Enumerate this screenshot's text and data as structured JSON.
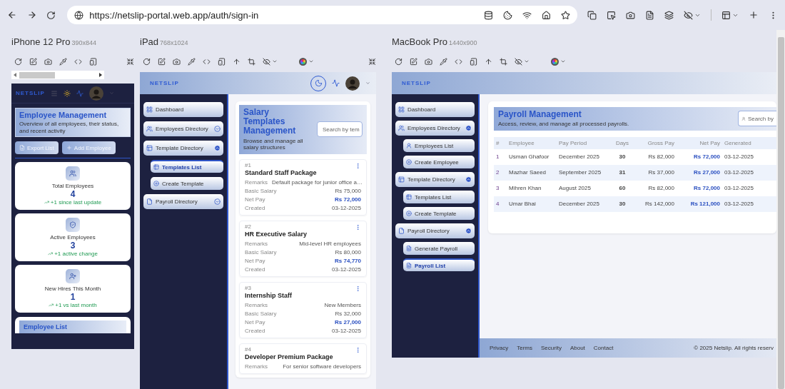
{
  "browser": {
    "url": "https://netslip-portal.web.app/auth/sign-in"
  },
  "devices": [
    {
      "kind": "phone",
      "name": "iPhone 12 Pro",
      "size": "390x844",
      "screen": {
        "brand": "NETSLIP",
        "title": "Employee Management",
        "subtitle": "Overview of all employees, their status, and recent activity",
        "actions": [
          "Export List",
          "Add Employee"
        ],
        "stats": [
          {
            "label": "Total Employees",
            "value": "4",
            "change": "+1 since last update"
          },
          {
            "label": "Active Employees",
            "value": "3",
            "change": "+1 active change"
          },
          {
            "label": "New Hires This Month",
            "value": "1",
            "change": "+1 vs last month"
          }
        ],
        "list_title": "Employee List"
      }
    },
    {
      "kind": "tablet",
      "name": "iPad",
      "size": "768x1024",
      "screen": {
        "brand": "NETSLIP",
        "sidebar": [
          {
            "label": "Dashboard",
            "selected": false
          },
          {
            "label": "Employees Directory",
            "selected": false,
            "expanded": false
          },
          {
            "label": "Template Directory",
            "selected": false,
            "expanded": true,
            "children": [
              {
                "label": "Templates List",
                "selected": true
              },
              {
                "label": "Create Template",
                "selected": false
              }
            ]
          },
          {
            "label": "Payroll Directory",
            "selected": false,
            "expanded": false
          }
        ],
        "title": "Salary Templates Management",
        "subtitle": "Browse and manage all salary structures",
        "search_placeholder": "Search by tem",
        "templates": [
          {
            "number": "#1",
            "name": "Standard Staff Package",
            "fields": [
              {
                "label": "Remarks",
                "value": "Default package for junior office a…",
                "highlight": false
              },
              {
                "label": "Basic Salary",
                "value": "Rs 75,000",
                "highlight": false
              },
              {
                "label": "Net Pay",
                "value": "Rs 72,000",
                "highlight": true
              },
              {
                "label": "Created",
                "value": "03-12-2025",
                "highlight": false
              }
            ]
          },
          {
            "number": "#2",
            "name": "HR Executive Salary",
            "fields": [
              {
                "label": "Remarks",
                "value": "Mid-level HR employees",
                "highlight": false
              },
              {
                "label": "Basic Salary",
                "value": "Rs 80,000",
                "highlight": false
              },
              {
                "label": "Net Pay",
                "value": "Rs 74,770",
                "highlight": true
              },
              {
                "label": "Created",
                "value": "03-12-2025",
                "highlight": false
              }
            ]
          },
          {
            "number": "#3",
            "name": "Internship Staff",
            "fields": [
              {
                "label": "Remarks",
                "value": "New Members",
                "highlight": false
              },
              {
                "label": "Basic Salary",
                "value": "Rs 32,000",
                "highlight": false
              },
              {
                "label": "Net Pay",
                "value": "Rs 27,000",
                "highlight": true
              },
              {
                "label": "Created",
                "value": "03-12-2025",
                "highlight": false
              }
            ]
          },
          {
            "number": "#4",
            "name": "Developer Premium Package",
            "fields": [
              {
                "label": "Remarks",
                "value": "For senior software developers",
                "highlight": false
              }
            ]
          }
        ]
      }
    },
    {
      "kind": "desktop",
      "name": "MacBook Pro",
      "size": "1440x900",
      "screen": {
        "brand": "NETSLIP",
        "sidebar": [
          {
            "label": "Dashboard",
            "selected": false
          },
          {
            "label": "Employees Directory",
            "selected": false,
            "expanded": true,
            "children": [
              {
                "label": "Employees List",
                "selected": false
              },
              {
                "label": "Create Employee",
                "selected": false
              }
            ]
          },
          {
            "label": "Template Directory",
            "selected": false,
            "expanded": true,
            "children": [
              {
                "label": "Templates List",
                "selected": false
              },
              {
                "label": "Create Template",
                "selected": false
              }
            ]
          },
          {
            "label": "Payroll Directory",
            "selected": false,
            "expanded": true,
            "children": [
              {
                "label": "Generate Payroll",
                "selected": false
              },
              {
                "label": "Payroll List",
                "selected": true
              }
            ]
          }
        ],
        "title": "Payroll Management",
        "subtitle": "Access, review, and manage all processed payrolls.",
        "search_placeholder": "Search by",
        "table": {
          "columns": [
            "#",
            "Employee",
            "Pay Period",
            "Days",
            "Gross Pay",
            "Net Pay",
            "Generated"
          ],
          "rows": [
            [
              "1",
              "Usman Ghafoor",
              "December 2025",
              "30",
              "Rs 82,000",
              "Rs 72,000",
              "03-12-2025"
            ],
            [
              "2",
              "Mazhar Saeed",
              "September 2025",
              "31",
              "Rs 37,000",
              "Rs 27,000",
              "03-12-2025"
            ],
            [
              "3",
              "Mihren Khan",
              "August 2025",
              "60",
              "Rs 82,000",
              "Rs 72,000",
              "03-12-2025"
            ],
            [
              "4",
              "Umar Bhai",
              "December 2025",
              "30",
              "Rs 142,000",
              "Rs 121,000",
              "03-12-2025"
            ]
          ]
        },
        "footer": {
          "links": [
            "Privacy",
            "Terms",
            "Security",
            "About",
            "Contact"
          ],
          "copyright": "© 2025 Netslip. All rights reserv"
        }
      }
    }
  ]
}
